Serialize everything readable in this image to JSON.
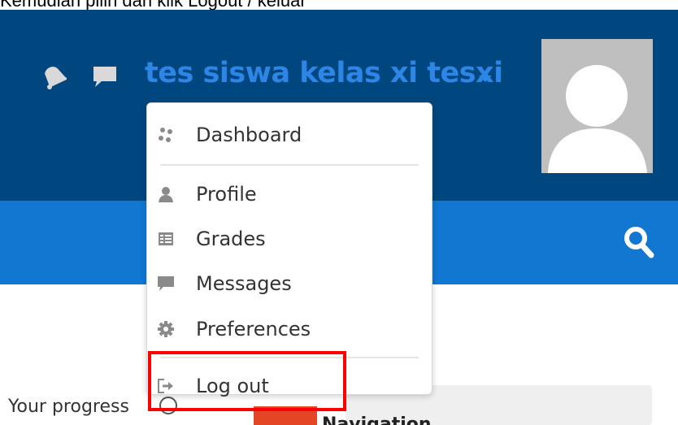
{
  "caption": "Kemudian pilih dan klik Logout / keluar",
  "header": {
    "username": "tes siswa kelas xi tesxi"
  },
  "user_menu": {
    "items": [
      {
        "label": "Dashboard",
        "icon": "dashboard-icon"
      },
      {
        "label": "Profile",
        "icon": "user-icon"
      },
      {
        "label": "Grades",
        "icon": "grades-table-icon"
      },
      {
        "label": "Messages",
        "icon": "chat-bubble-icon"
      },
      {
        "label": "Preferences",
        "icon": "gear-icon"
      },
      {
        "label": "Log out",
        "icon": "logout-icon"
      }
    ]
  },
  "page": {
    "progress_label": "Your progress",
    "card_title": "Navigation"
  },
  "colors": {
    "header_dark_blue": "#00477f",
    "navbar_blue": "#1177d1",
    "username_blue": "#2d85e6",
    "highlight_red": "#ff0000"
  }
}
